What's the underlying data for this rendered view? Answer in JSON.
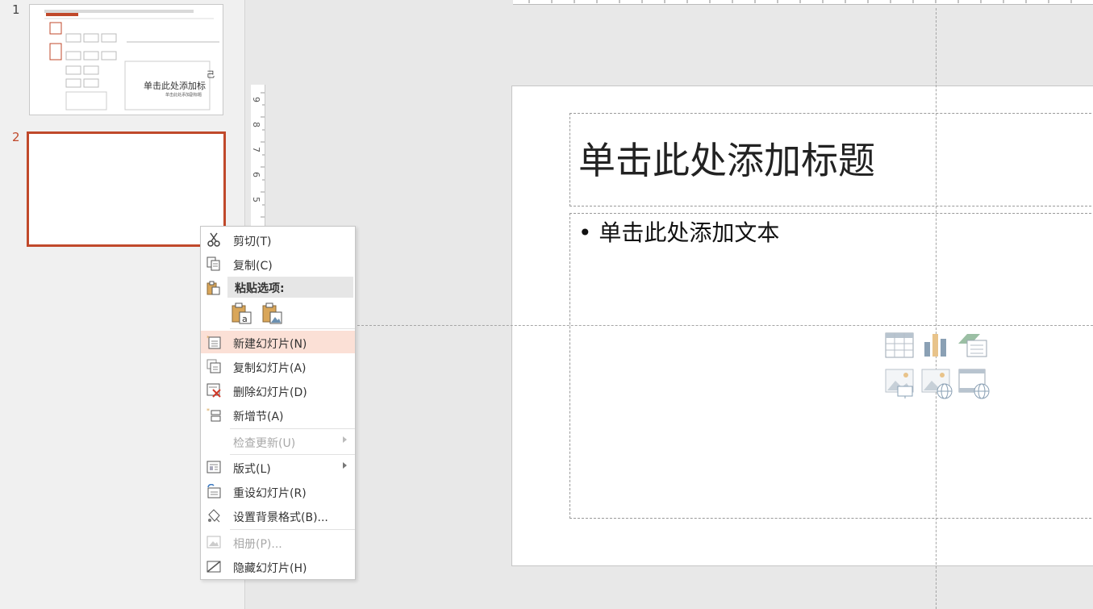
{
  "thumbnails": {
    "slide1": {
      "number": "1",
      "title": "单击此处添加标",
      "subtitle": "单击此处添加副标题",
      "edge_char": "己"
    },
    "slide2": {
      "number": "2"
    }
  },
  "ruler": {
    "vertical_numbers": [
      "9",
      "8",
      "7",
      "6",
      "5"
    ]
  },
  "slide": {
    "title_placeholder": "单击此处添加标题",
    "body_placeholder": "• 单击此处添加文本",
    "content_icons": [
      "table-icon",
      "chart-icon",
      "smartart-icon",
      "picture-icon",
      "online-picture-icon",
      "video-icon"
    ]
  },
  "context_menu": {
    "cut": "剪切(T)",
    "copy": "复制(C)",
    "paste_options": "粘贴选项:",
    "paste_option_icons": [
      "keep-text-only-paste-icon",
      "picture-paste-icon"
    ],
    "new_slide": "新建幻灯片(N)",
    "duplicate_slide": "复制幻灯片(A)",
    "delete_slide": "删除幻灯片(D)",
    "add_section": "新增节(A)",
    "check_updates": "检查更新(U)",
    "layout": "版式(L)",
    "reset_slide": "重设幻灯片(R)",
    "format_background": "设置背景格式(B)...",
    "photo_album": "相册(P)...",
    "hide_slide": "隐藏幻灯片(H)"
  },
  "colors": {
    "accent": "#c0492b",
    "highlight": "#fbe0d6"
  }
}
